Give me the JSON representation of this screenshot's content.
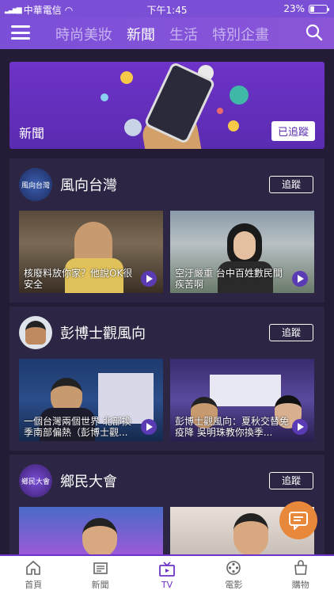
{
  "status": {
    "carrier": "中華電信",
    "time": "下午1:45",
    "battery": "23%"
  },
  "topnav": {
    "tabs": [
      "時尚美妝",
      "新聞",
      "生活",
      "特別企畫"
    ],
    "active": "新聞"
  },
  "banner": {
    "title": "新聞",
    "button": "已追蹤"
  },
  "sections": [
    {
      "title": "風向台灣",
      "avatar_text": "風向台灣",
      "follow": "追蹤",
      "videos": [
        {
          "caption": "核廢料放你家？他說OK很安全"
        },
        {
          "caption": "空汙嚴重 台中百姓數民間疾苦啊"
        }
      ]
    },
    {
      "title": "彭博士觀風向",
      "follow": "追蹤",
      "videos": [
        {
          "caption": "一個台灣兩個世界 北部換季南部偏熱（彭博士觀..."
        },
        {
          "caption": "彭博士觀風向：夏秋交替免疫降 吳明珠教你換季..."
        }
      ]
    },
    {
      "title": "鄉民大會",
      "avatar_text": "鄉民大會",
      "follow": "追蹤",
      "videos": [
        {
          "caption": ""
        },
        {
          "caption": ""
        }
      ]
    }
  ],
  "bottombar": [
    {
      "label": "首頁",
      "icon": "home-icon"
    },
    {
      "label": "新聞",
      "icon": "news-icon"
    },
    {
      "label": "TV",
      "icon": "tv-icon"
    },
    {
      "label": "電影",
      "icon": "film-icon"
    },
    {
      "label": "購物",
      "icon": "shopping-bag-icon"
    }
  ],
  "colors": {
    "accent": "#6e33c8",
    "nav": "#7a4fd6",
    "background": "#241c36",
    "fab": "#e7883a"
  }
}
